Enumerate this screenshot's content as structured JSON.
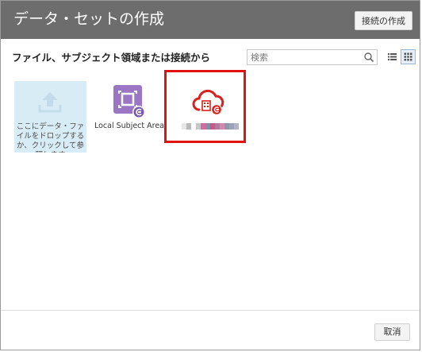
{
  "dialog": {
    "title": "データ・セットの作成",
    "create_connection_label": "接続の作成",
    "subheader": "ファイル、サブジェクト領域または接続から",
    "search": {
      "placeholder": "検索"
    },
    "view_modes": [
      "list-view-icon",
      "grid-view-icon"
    ],
    "active_view": "grid"
  },
  "tiles": {
    "drop": {
      "text": "ここにデータ・ファイルをドロップするか、クリックして参照します",
      "icon": "upload-icon"
    },
    "local_subject_area": {
      "label": "Local Subject Area",
      "icon": "subject-area-icon"
    },
    "connection": {
      "label_obscured": true,
      "icon": "cloud-connection-icon",
      "highlight": "#e01212"
    }
  },
  "footer": {
    "cancel_label": "取消"
  },
  "colors": {
    "titlebar": "#6d6d6d",
    "drop_tile_bg": "#d8ecf6",
    "subject_purple": "#9a76c4",
    "cloud_red": "#d9201c"
  }
}
